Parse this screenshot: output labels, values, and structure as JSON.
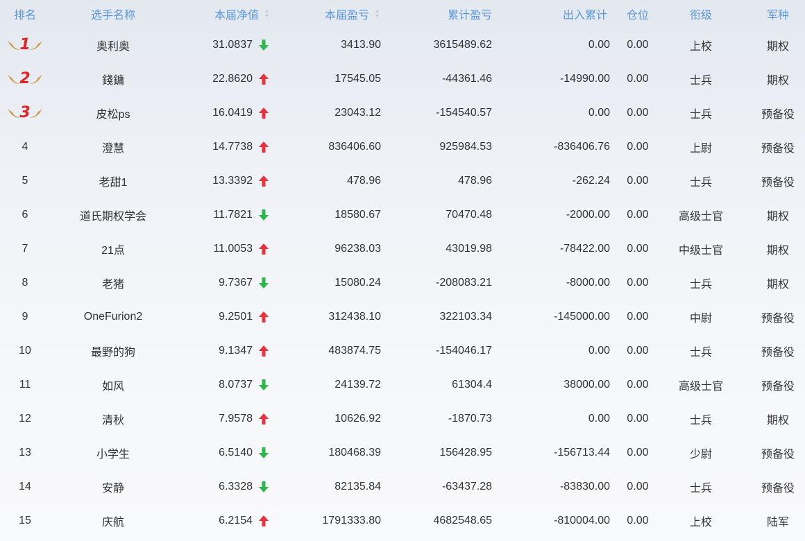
{
  "headers": {
    "rank": "排名",
    "name": "选手名称",
    "nav": "本届净值",
    "pnl": "本届盈亏",
    "cum": "累计盈亏",
    "io": "出入累计",
    "pos": "仓位",
    "ranktitle": "衔级",
    "arm": "军种"
  },
  "icons": {
    "up": "arrow-up-icon",
    "down": "arrow-down-icon",
    "up_color": "#e8323c",
    "down_color": "#2eb84a",
    "wing_color": "#c89a4a"
  },
  "rows": [
    {
      "rank": "1",
      "name": "奥利奥",
      "nav": "31.0837",
      "dir": "down",
      "pnl": "3413.90",
      "cum": "3615489.62",
      "io": "0.00",
      "pos": "0.00",
      "ranktitle": "上校",
      "arm": "期权"
    },
    {
      "rank": "2",
      "name": "錢鏞",
      "nav": "22.8620",
      "dir": "up",
      "pnl": "17545.05",
      "cum": "-44361.46",
      "io": "-14990.00",
      "pos": "0.00",
      "ranktitle": "士兵",
      "arm": "期权"
    },
    {
      "rank": "3",
      "name": "皮松ps",
      "nav": "16.0419",
      "dir": "up",
      "pnl": "23043.12",
      "cum": "-154540.57",
      "io": "0.00",
      "pos": "0.00",
      "ranktitle": "士兵",
      "arm": "预备役"
    },
    {
      "rank": "4",
      "name": "澄慧",
      "nav": "14.7738",
      "dir": "up",
      "pnl": "836406.60",
      "cum": "925984.53",
      "io": "-836406.76",
      "pos": "0.00",
      "ranktitle": "上尉",
      "arm": "预备役"
    },
    {
      "rank": "5",
      "name": "老甜1",
      "nav": "13.3392",
      "dir": "up",
      "pnl": "478.96",
      "cum": "478.96",
      "io": "-262.24",
      "pos": "0.00",
      "ranktitle": "士兵",
      "arm": "预备役"
    },
    {
      "rank": "6",
      "name": "道氏期权学会",
      "nav": "11.7821",
      "dir": "down",
      "pnl": "18580.67",
      "cum": "70470.48",
      "io": "-2000.00",
      "pos": "0.00",
      "ranktitle": "高级士官",
      "arm": "期权"
    },
    {
      "rank": "7",
      "name": "21点",
      "nav": "11.0053",
      "dir": "up",
      "pnl": "96238.03",
      "cum": "43019.98",
      "io": "-78422.00",
      "pos": "0.00",
      "ranktitle": "中级士官",
      "arm": "期权"
    },
    {
      "rank": "8",
      "name": "老猪",
      "nav": "9.7367",
      "dir": "down",
      "pnl": "15080.24",
      "cum": "-208083.21",
      "io": "-8000.00",
      "pos": "0.00",
      "ranktitle": "士兵",
      "arm": "期权"
    },
    {
      "rank": "9",
      "name": "OneFurion2",
      "nav": "9.2501",
      "dir": "up",
      "pnl": "312438.10",
      "cum": "322103.34",
      "io": "-145000.00",
      "pos": "0.00",
      "ranktitle": "中尉",
      "arm": "预备役"
    },
    {
      "rank": "10",
      "name": "最野的狗",
      "nav": "9.1347",
      "dir": "up",
      "pnl": "483874.75",
      "cum": "-154046.17",
      "io": "0.00",
      "pos": "0.00",
      "ranktitle": "士兵",
      "arm": "预备役"
    },
    {
      "rank": "11",
      "name": "如风",
      "nav": "8.0737",
      "dir": "down",
      "pnl": "24139.72",
      "cum": "61304.4",
      "io": "38000.00",
      "pos": "0.00",
      "ranktitle": "高级士官",
      "arm": "预备役"
    },
    {
      "rank": "12",
      "name": "清秋",
      "nav": "7.9578",
      "dir": "up",
      "pnl": "10626.92",
      "cum": "-1870.73",
      "io": "0.00",
      "pos": "0.00",
      "ranktitle": "士兵",
      "arm": "期权"
    },
    {
      "rank": "13",
      "name": "小学生",
      "nav": "6.5140",
      "dir": "down",
      "pnl": "180468.39",
      "cum": "156428.95",
      "io": "-156713.44",
      "pos": "0.00",
      "ranktitle": "少尉",
      "arm": "预备役"
    },
    {
      "rank": "14",
      "name": "安静",
      "nav": "6.3328",
      "dir": "down",
      "pnl": "82135.84",
      "cum": "-63437.28",
      "io": "-83830.00",
      "pos": "0.00",
      "ranktitle": "士兵",
      "arm": "预备役"
    },
    {
      "rank": "15",
      "name": "庆航",
      "nav": "6.2154",
      "dir": "up",
      "pnl": "1791333.80",
      "cum": "4682548.65",
      "io": "-810004.00",
      "pos": "0.00",
      "ranktitle": "上校",
      "arm": "陆军"
    }
  ]
}
